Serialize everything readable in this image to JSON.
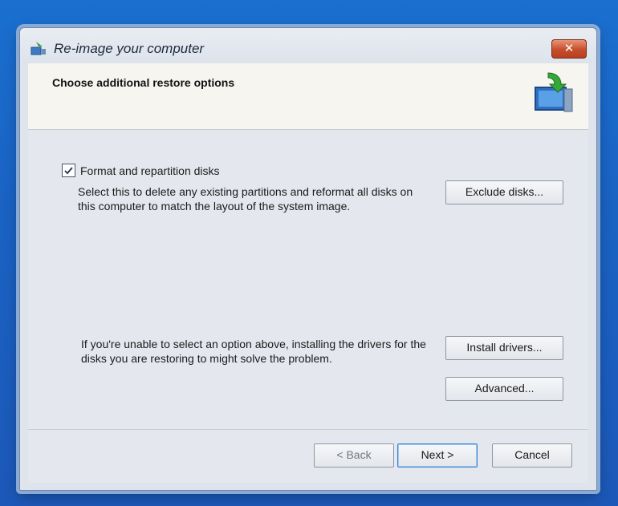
{
  "window": {
    "title": "Re-image your computer",
    "close_label": "✕"
  },
  "header": {
    "title": "Choose additional restore options"
  },
  "format": {
    "checkbox_label": "Format and repartition disks",
    "checked": true,
    "description": "Select this to delete any existing partitions and reformat all disks on this computer to match the layout of the system image.",
    "exclude_label": "Exclude disks..."
  },
  "drivers": {
    "description": "If you're unable to select an option above, installing the drivers for the disks you are restoring to might solve the problem.",
    "install_label": "Install drivers...",
    "advanced_label": "Advanced..."
  },
  "footer": {
    "back_label": "< Back",
    "next_label": "Next >",
    "cancel_label": "Cancel"
  },
  "icons": {
    "title_icon": "reimage-icon",
    "header_icon": "computer-restore-icon",
    "checkbox_mark": "checkmark-icon"
  },
  "colors": {
    "desktop": "#1a6fcf",
    "close_button": "#c64d2b",
    "next_focus": "#3b83d1"
  }
}
